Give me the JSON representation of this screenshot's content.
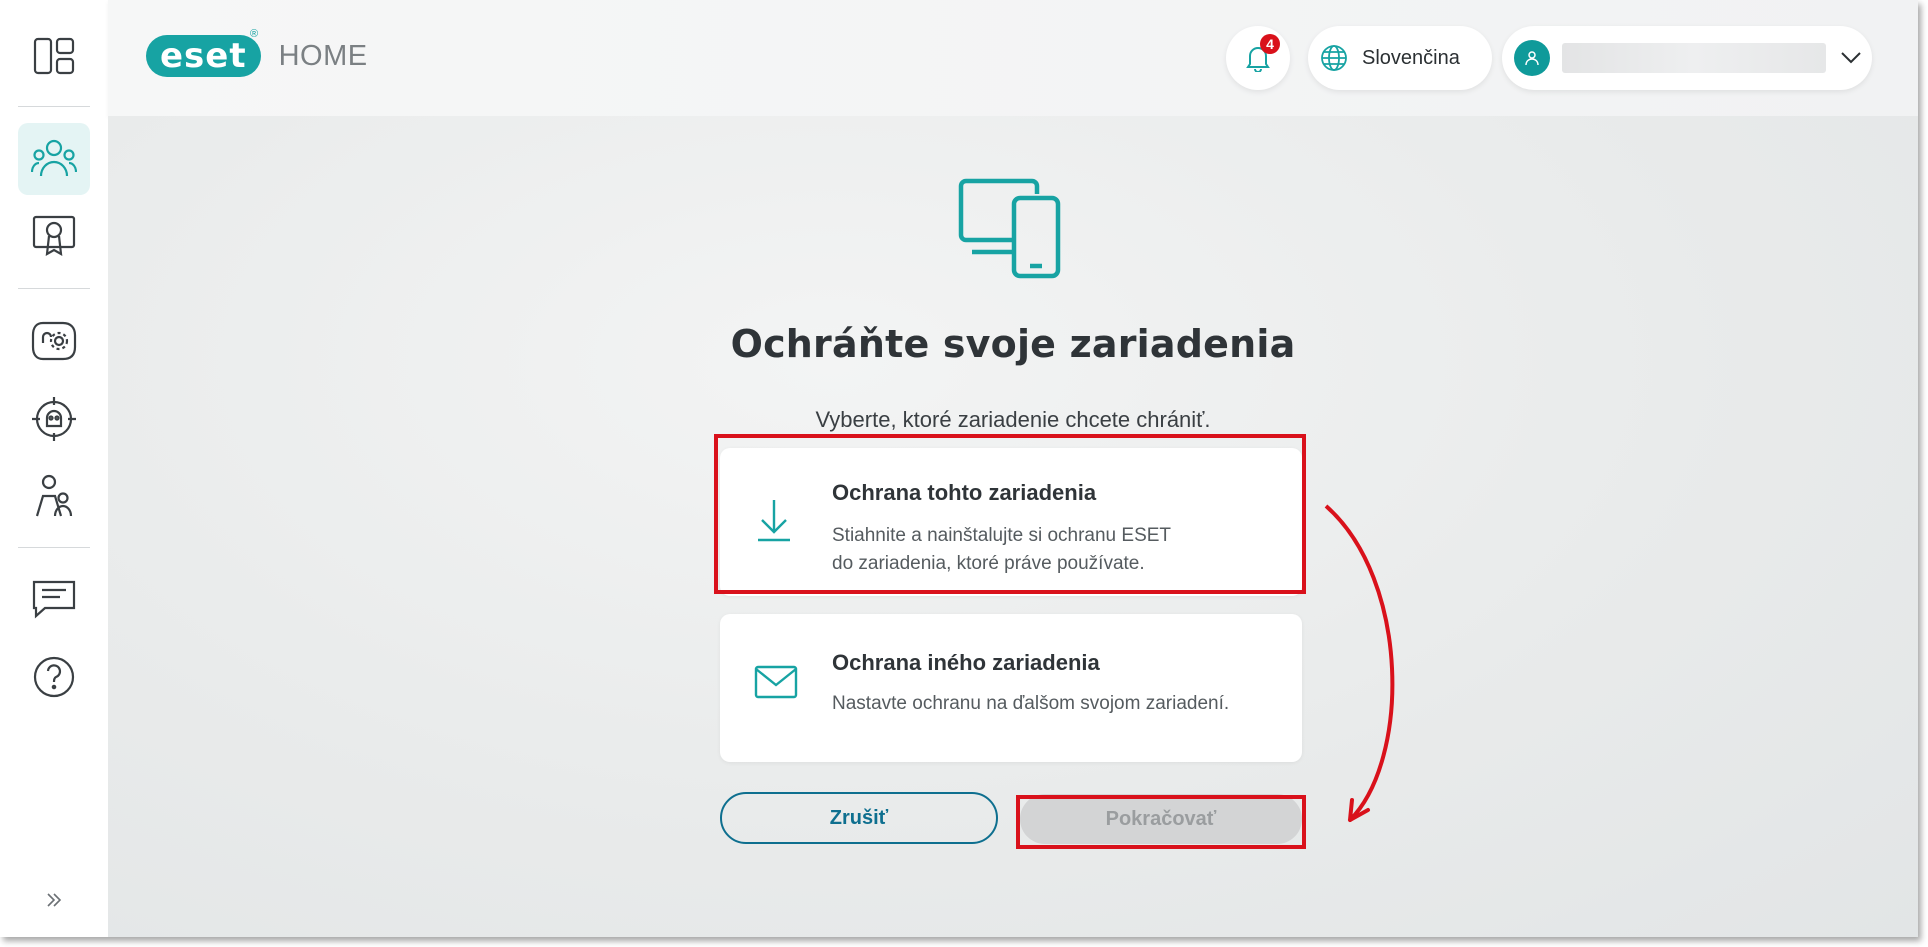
{
  "sidebar": {
    "items": [
      {
        "icon": "dashboard-icon"
      },
      {
        "icon": "people-icon",
        "active": true
      },
      {
        "icon": "license-certificate-icon"
      },
      {
        "icon": "anti-theft-settings-icon"
      },
      {
        "icon": "security-target-icon"
      },
      {
        "icon": "family-parental-icon"
      },
      {
        "icon": "feedback-message-icon"
      },
      {
        "icon": "help-icon"
      }
    ],
    "expand_icon": "double-chevron-right-icon"
  },
  "header": {
    "logo_text": "eset",
    "logo_suffix": "HOME",
    "notification_count": "4",
    "language": "Slovenčina",
    "account_name": "",
    "accent_color": "#17a3a3"
  },
  "main": {
    "title": "Ochráňte svoje zariadenia",
    "subtitle": "Vyberte, ktoré zariadenie chcete chrániť.",
    "options": [
      {
        "title": "Ochrana tohto zariadenia",
        "desc_line1": "Stiahnite a nainštalujte si ochranu ESET",
        "desc_line2": "do zariadenia, ktoré práve používate.",
        "icon": "download-icon"
      },
      {
        "title": "Ochrana iného zariadenia",
        "desc_line1": "Nastavte ochranu na ďalšom svojom zariadení.",
        "icon": "email-icon"
      }
    ],
    "cancel_label": "Zrušiť",
    "continue_label": "Pokračovať"
  },
  "annotation_color": "#d9111b"
}
